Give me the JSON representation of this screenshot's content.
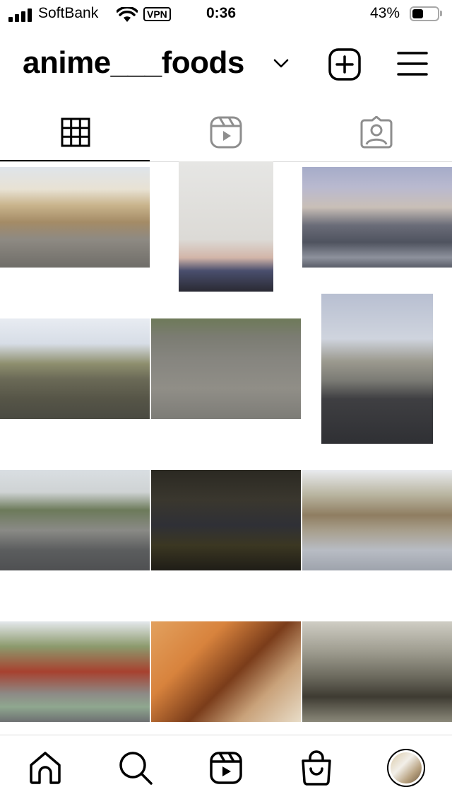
{
  "status_bar": {
    "carrier": "SoftBank",
    "vpn": "VPN",
    "time": "0:36",
    "battery": "43%",
    "battery_level": 0.43
  },
  "header": {
    "username": "anime___foods",
    "dropdown_icon": "chevron-down-icon",
    "new_post_icon": "plus-square-icon",
    "menu_icon": "hamburger-menu-icon"
  },
  "tabs": [
    {
      "name": "grid",
      "icon": "grid-icon",
      "selected": true
    },
    {
      "name": "reels",
      "icon": "reels-icon",
      "selected": false
    },
    {
      "name": "tagged",
      "icon": "tagged-person-icon",
      "selected": false
    }
  ],
  "posts": [
    {
      "id": 1,
      "subject": "residential street with houses"
    },
    {
      "id": 2,
      "subject": "building under pale sky with green sign"
    },
    {
      "id": 3,
      "subject": "crosswalk with silver car"
    },
    {
      "id": 4,
      "subject": "retaining wall with weeds and scooters"
    },
    {
      "id": 5,
      "subject": "red and white barriers"
    },
    {
      "id": 6,
      "subject": "road with utility poles"
    },
    {
      "id": 7,
      "subject": "narrow street with parked cars"
    },
    {
      "id": 8,
      "subject": "parking lot with yellow machine at night"
    },
    {
      "id": 9,
      "subject": "playground and road"
    },
    {
      "id": 10,
      "subject": "street with red wall mural"
    },
    {
      "id": 11,
      "subject": "bass guitar in room"
    },
    {
      "id": 12,
      "subject": "concrete drainage ditch"
    }
  ],
  "bottom_nav": [
    {
      "name": "home",
      "icon": "home-icon"
    },
    {
      "name": "search",
      "icon": "search-icon"
    },
    {
      "name": "reels",
      "icon": "reels-icon"
    },
    {
      "name": "shop",
      "icon": "shop-bag-icon"
    },
    {
      "name": "profile",
      "icon": "avatar"
    }
  ],
  "colors": {
    "text": "#000000",
    "divider": "#dbdbdb",
    "background": "#ffffff",
    "inactive_icon": "#8e8e8e"
  }
}
